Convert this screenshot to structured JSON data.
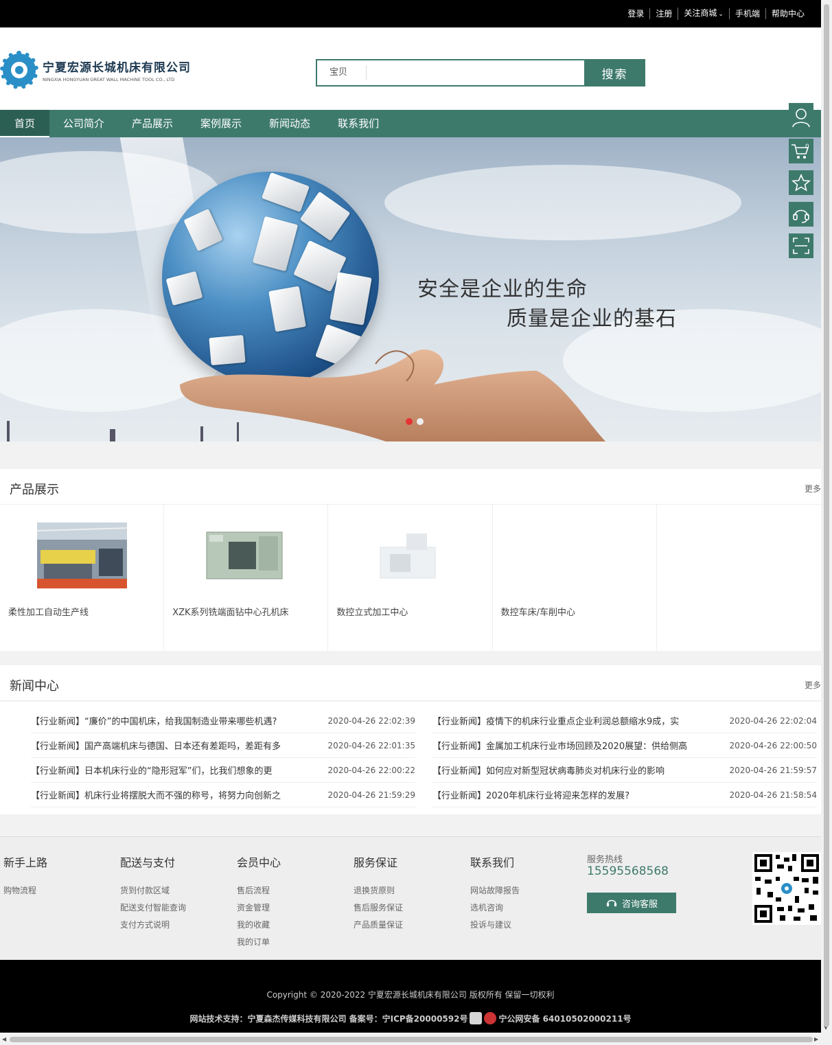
{
  "topbar": {
    "links": [
      "登录",
      "注册",
      "关注商城",
      "手机端",
      "帮助中心"
    ]
  },
  "logo": {
    "cn": "宁夏宏源长城机床有限公司",
    "en": "NINGXIA HONGYUAN GREAT WALL MACHINE TOOL CO., LTD"
  },
  "search": {
    "scope": "宝贝",
    "value": "",
    "button": "搜索"
  },
  "nav": {
    "items": [
      "首页",
      "公司简介",
      "产品展示",
      "案例展示",
      "新闻动态",
      "联系我们"
    ],
    "active": "首页"
  },
  "banner": {
    "line1": "安全是企业的生命",
    "line2": "质量是企业的基石",
    "slides": 2,
    "active_slide": 1
  },
  "sidetools": [
    "user-icon",
    "cart-icon",
    "star-icon",
    "headset-icon",
    "scan-icon"
  ],
  "cart_count": "0",
  "products": {
    "title": "产品展示",
    "more": "更多",
    "items": [
      {
        "name": "柔性加工自动生产线"
      },
      {
        "name": "XZK系列铣端面钻中心孔机床"
      },
      {
        "name": "数控立式加工中心"
      },
      {
        "name": "数控车床/车削中心"
      },
      {
        "name": ""
      }
    ]
  },
  "news": {
    "title": "新闻中心",
    "more": "更多",
    "left": [
      {
        "title": "【行业新闻】“廉价”的中国机床，给我国制造业带来哪些机遇?",
        "date": "2020-04-26 22:02:39"
      },
      {
        "title": "【行业新闻】国产高端机床与德国、日本还有差距吗，差距有多",
        "date": "2020-04-26 22:01:35"
      },
      {
        "title": "【行业新闻】日本机床行业的“隐形冠军”们，比我们想象的更",
        "date": "2020-04-26 22:00:22"
      },
      {
        "title": "【行业新闻】机床行业将摆脱大而不强的称号，将努力向创新之",
        "date": "2020-04-26 21:59:29"
      }
    ],
    "right": [
      {
        "title": "【行业新闻】疫情下的机床行业重点企业利润总额缩水9成，实",
        "date": "2020-04-26 22:02:04"
      },
      {
        "title": "【行业新闻】金属加工机床行业市场回顾及2020展望：供给侧高",
        "date": "2020-04-26 22:00:50"
      },
      {
        "title": "【行业新闻】如何应对新型冠状病毒肺炎对机床行业的影响",
        "date": "2020-04-26 21:59:57"
      },
      {
        "title": "【行业新闻】2020年机床行业将迎来怎样的发展?",
        "date": "2020-04-26 21:58:54"
      }
    ]
  },
  "footer": {
    "columns": [
      {
        "title": "新手上路",
        "links": [
          "购物流程"
        ]
      },
      {
        "title": "配送与支付",
        "links": [
          "货到付款区域",
          "配送支付智能查询",
          "支付方式说明"
        ]
      },
      {
        "title": "会员中心",
        "links": [
          "售后流程",
          "资金管理",
          "我的收藏",
          "我的订单"
        ]
      },
      {
        "title": "服务保证",
        "links": [
          "退换货原则",
          "售后服务保证",
          "产品质量保证"
        ]
      },
      {
        "title": "联系我们",
        "links": [
          "网站故障报告",
          "选机咨询",
          "投诉与建议"
        ]
      }
    ],
    "hotline_label": "服务热线",
    "hotline": "15595568568",
    "consult": "咨询客服"
  },
  "copyright": {
    "line1": "Copyright © 2020-2022 宁夏宏源长城机床有限公司 版权所有 保留一切权利",
    "line2a": "网站技术支持：宁夏森杰传媒科技有限公司 备案号：宁ICP备20000592号",
    "line2b": "宁公网安备 64010502000211号"
  },
  "colors": {
    "brand": "#3e7a6c",
    "topbar": "#000000",
    "slide_active": "#e53333"
  }
}
